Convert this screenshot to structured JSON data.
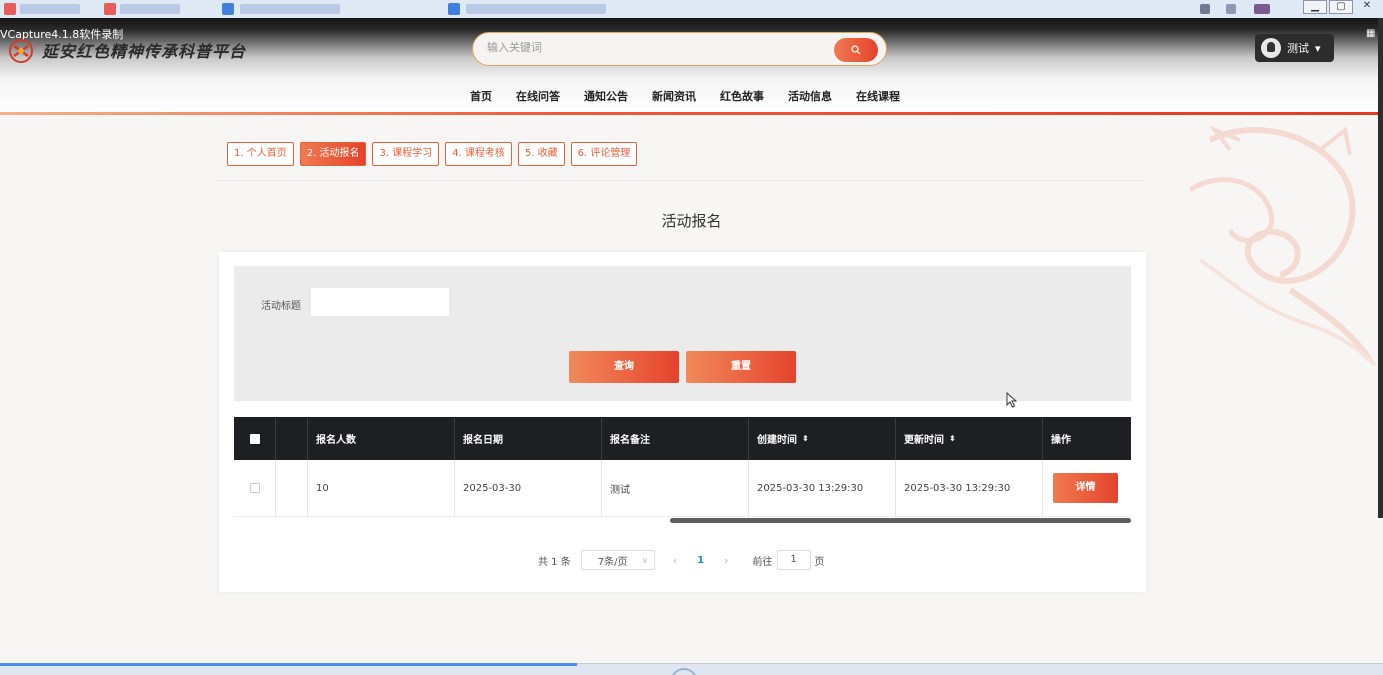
{
  "capture_label": "VCapture4.1.8软件录制",
  "site": {
    "title": "延安红色精神传承科普平台"
  },
  "search": {
    "placeholder": "输入关键词"
  },
  "user": {
    "name": "测试",
    "caret": "▾"
  },
  "nav": [
    {
      "label": "首页"
    },
    {
      "label": "在线问答"
    },
    {
      "label": "通知公告"
    },
    {
      "label": "新闻资讯"
    },
    {
      "label": "红色故事"
    },
    {
      "label": "活动信息"
    },
    {
      "label": "在线课程"
    }
  ],
  "tabs": [
    {
      "label": "1. 个人首页",
      "active": false
    },
    {
      "label": "2. 活动报名",
      "active": true
    },
    {
      "label": "3. 课程学习",
      "active": false
    },
    {
      "label": "4. 课程考核",
      "active": false
    },
    {
      "label": "5. 收藏",
      "active": false
    },
    {
      "label": "6. 评论管理",
      "active": false
    }
  ],
  "page_title": "活动报名",
  "filter": {
    "label": "活动标题",
    "value": "",
    "query_button": "查询",
    "reset_button": "重置"
  },
  "table": {
    "headers": [
      "报名人数",
      "报名日期",
      "报名备注",
      "创建时间",
      "更新时间",
      "操作"
    ],
    "sort_glyph": "⬍",
    "rows": [
      {
        "count": "10",
        "date": "2025-03-30",
        "note": "测试",
        "created": "2025-03-30 13:29:30",
        "updated": "2025-03-30 13:29:30",
        "action": "详情"
      }
    ]
  },
  "pagination": {
    "total": "共 1 条",
    "page_size": "7条/页",
    "prev": "‹",
    "current": "1",
    "next": "›",
    "goto_label": "前往",
    "goto_value": "1",
    "goto_unit": "页"
  },
  "colors": {
    "accent": "#e9603a",
    "accent_dark": "#e5432c",
    "table_header": "#1e1f22",
    "link_blue": "#1e80ff"
  }
}
